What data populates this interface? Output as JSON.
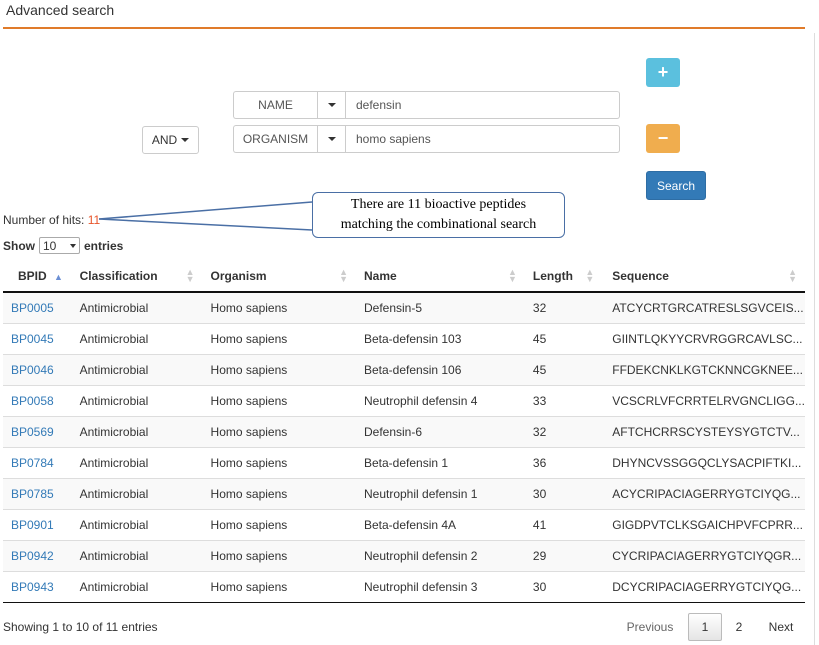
{
  "header": {
    "title": "Advanced search",
    "accent_color": "#e07b2a"
  },
  "search": {
    "operator": "AND",
    "rows": [
      {
        "field": "NAME",
        "value": "defensin"
      },
      {
        "field": "ORGANISM",
        "value": "homo sapiens"
      }
    ],
    "add_icon": "plus-icon",
    "remove_icon": "minus-icon",
    "search_label": "Search"
  },
  "callout": {
    "line1": "There are 11 bioactive peptides",
    "line2": "matching the combinational search"
  },
  "results": {
    "hits_label": "Number of hits:",
    "hits_count": "11",
    "show_label": "Show",
    "page_size": "10",
    "entries_label": "entries",
    "columns": [
      "BPID",
      "Classification",
      "Organism",
      "Name",
      "Length",
      "Sequence"
    ],
    "rows": [
      [
        "BP0005",
        "Antimicrobial",
        "Homo sapiens",
        "Defensin-5",
        "32",
        "ATCYCRTGRCATRESLSGVCEIS..."
      ],
      [
        "BP0045",
        "Antimicrobial",
        "Homo sapiens",
        "Beta-defensin 103",
        "45",
        "GIINTLQKYYCRVRGGRCAVLSC..."
      ],
      [
        "BP0046",
        "Antimicrobial",
        "Homo sapiens",
        "Beta-defensin 106",
        "45",
        "FFDEKCNKLKGTCKNNCGKNEE..."
      ],
      [
        "BP0058",
        "Antimicrobial",
        "Homo sapiens",
        "Neutrophil defensin 4",
        "33",
        "VCSCRLVFCRRTELRVGNCLIGG..."
      ],
      [
        "BP0569",
        "Antimicrobial",
        "Homo sapiens",
        "Defensin-6",
        "32",
        "AFTCHCRRSCYSTEYSYGTCTV..."
      ],
      [
        "BP0784",
        "Antimicrobial",
        "Homo sapiens",
        "Beta-defensin 1",
        "36",
        "DHYNCVSSGGQCLYSACPIFTKI..."
      ],
      [
        "BP0785",
        "Antimicrobial",
        "Homo sapiens",
        "Neutrophil defensin 1",
        "30",
        "ACYCRIPACIAGERRYGTCIYQG..."
      ],
      [
        "BP0901",
        "Antimicrobial",
        "Homo sapiens",
        "Beta-defensin 4A",
        "41",
        "GIGDPVTCLKSGAICHPVFCPRR..."
      ],
      [
        "BP0942",
        "Antimicrobial",
        "Homo sapiens",
        "Neutrophil defensin 2",
        "29",
        "CYCRIPACIAGERRYGTCIYQGR..."
      ],
      [
        "BP0943",
        "Antimicrobial",
        "Homo sapiens",
        "Neutrophil defensin 3",
        "30",
        "DCYCRIPACIAGERRYGTCIYQG..."
      ]
    ]
  },
  "footer": {
    "showing": "Showing 1 to 10 of 11 entries",
    "previous": "Previous",
    "pages": [
      "1",
      "2"
    ],
    "next": "Next"
  }
}
